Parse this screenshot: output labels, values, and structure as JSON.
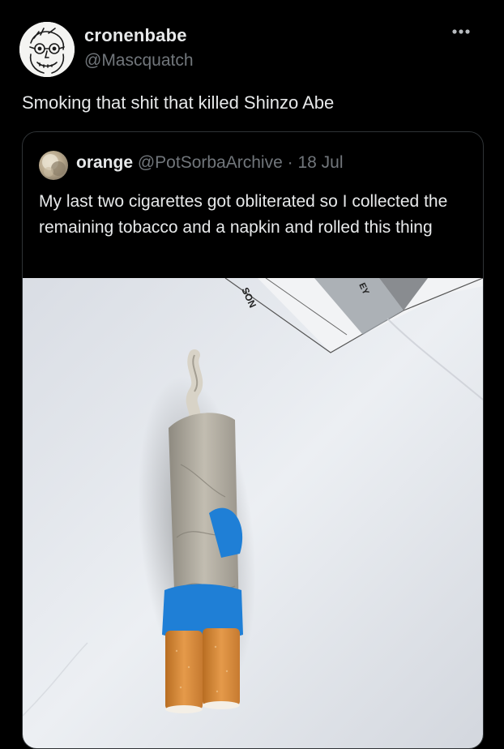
{
  "author": {
    "display_name": "cronenbabe",
    "handle": "@Mascquatch",
    "avatar_icon": "sketch-face-avatar"
  },
  "more_icon": "ellipsis-icon",
  "tweet_text": "Smoking that shit that killed Shinzo Abe",
  "quoted": {
    "display_name": "orange",
    "handle": "@PotSorbaArchive",
    "separator": "·",
    "date": "18 Jul",
    "text": "My last two cigarettes got obliterated so I collected the remaining tobacco and a napkin and rolled this thing",
    "image": {
      "paper_text_left": "SON",
      "paper_text_right": "EY",
      "colors": {
        "paper": "#e8ebf0",
        "tape": "#1f7fd6",
        "filter": "#d98a3a"
      }
    }
  },
  "colors": {
    "background": "#000000",
    "text_primary": "#e7e9ea",
    "text_secondary": "#71767b",
    "border": "#2f3336"
  }
}
